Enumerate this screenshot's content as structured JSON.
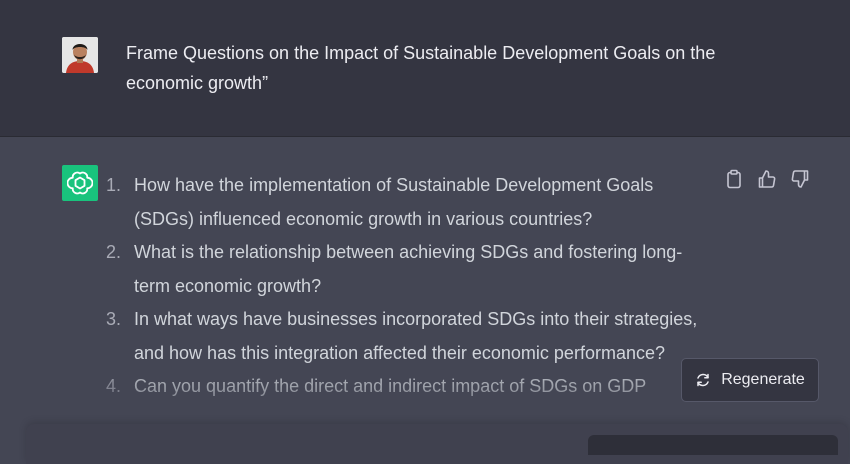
{
  "user_message": {
    "text": "Frame Questions on the Impact of Sustainable Development Goals on the economic growth”"
  },
  "assistant_message": {
    "items": [
      {
        "num": "1.",
        "text": "How have the implementation of Sustainable Development Goals (SDGs) influenced economic growth in various countries?"
      },
      {
        "num": "2.",
        "text": "What is the relationship between achieving SDGs and fostering long-term economic growth?"
      },
      {
        "num": "3.",
        "text": "In what ways have businesses incorporated SDGs into their strategies, and how has this integration affected their economic performance?"
      },
      {
        "num": "4.",
        "text": "Can you quantify the direct and indirect impact of SDGs on GDP"
      }
    ]
  },
  "actions": {
    "copy_icon": "clipboard-icon",
    "like_icon": "thumbs-up-icon",
    "dislike_icon": "thumbs-down-icon"
  },
  "regenerate": {
    "label": "Regenerate",
    "icon": "refresh-icon"
  },
  "colors": {
    "user_bg": "#343541",
    "assistant_bg": "#444654",
    "logo_green": "#19c37d",
    "text": "#ececf1"
  }
}
